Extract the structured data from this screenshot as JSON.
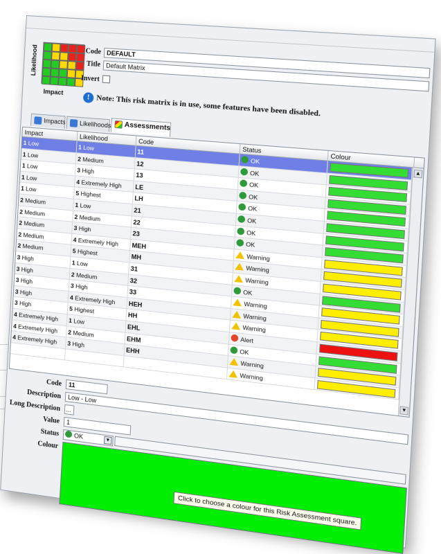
{
  "matrix": {
    "ylabel": "Likelihood",
    "xlabel": "Impact",
    "cells": [
      [
        "#22cc22",
        "#ffd800",
        "#e8221c",
        "#e8221c",
        "#e8221c"
      ],
      [
        "#22cc22",
        "#ffd800",
        "#ffd800",
        "#e8221c",
        "#e8221c"
      ],
      [
        "#22cc22",
        "#22cc22",
        "#ffd800",
        "#ffd800",
        "#e8221c"
      ],
      [
        "#22cc22",
        "#22cc22",
        "#22cc22",
        "#ffd800",
        "#ffd800"
      ],
      [
        "#22cc22",
        "#22cc22",
        "#22cc22",
        "#22cc22",
        "#ffd800"
      ]
    ]
  },
  "header": {
    "code_label": "Code",
    "code_value": "DEFAULT",
    "title_label": "Title",
    "title_value": "Default Matrix",
    "invert_label": "Invert",
    "note": "Note: This risk matrix is in use, some features have been disabled."
  },
  "tabs": [
    {
      "label": "Impacts",
      "icon": "shield-icon"
    },
    {
      "label": "Likelihoods",
      "icon": "shield-icon"
    },
    {
      "label": "Assessments",
      "icon": "matrix-icon"
    }
  ],
  "table": {
    "columns": [
      "Impact",
      "Likelihood",
      "Code",
      "Status",
      "Colour"
    ],
    "rows": [
      {
        "impact_num": "1",
        "impact": "Low",
        "like_num": "1",
        "like": "Low",
        "code": "11",
        "status": "OK",
        "status_type": "ok",
        "colour": "#33dd33"
      },
      {
        "impact_num": "1",
        "impact": "Low",
        "like_num": "2",
        "like": "Medium",
        "code": "12",
        "status": "OK",
        "status_type": "ok",
        "colour": "#33dd33"
      },
      {
        "impact_num": "1",
        "impact": "Low",
        "like_num": "3",
        "like": "High",
        "code": "13",
        "status": "OK",
        "status_type": "ok",
        "colour": "#33dd33"
      },
      {
        "impact_num": "1",
        "impact": "Low",
        "like_num": "4",
        "like": "Extremely High",
        "code": "LE",
        "status": "OK",
        "status_type": "ok",
        "colour": "#33dd33"
      },
      {
        "impact_num": "1",
        "impact": "Low",
        "like_num": "5",
        "like": "Highest",
        "code": "LH",
        "status": "OK",
        "status_type": "ok",
        "colour": "#33dd33"
      },
      {
        "impact_num": "2",
        "impact": "Medium",
        "like_num": "1",
        "like": "Low",
        "code": "21",
        "status": "OK",
        "status_type": "ok",
        "colour": "#33dd33"
      },
      {
        "impact_num": "2",
        "impact": "Medium",
        "like_num": "2",
        "like": "Medium",
        "code": "22",
        "status": "OK",
        "status_type": "ok",
        "colour": "#33dd33"
      },
      {
        "impact_num": "2",
        "impact": "Medium",
        "like_num": "3",
        "like": "High",
        "code": "23",
        "status": "OK",
        "status_type": "ok",
        "colour": "#33dd33"
      },
      {
        "impact_num": "2",
        "impact": "Medium",
        "like_num": "4",
        "like": "Extremely High",
        "code": "MEH",
        "status": "Warning",
        "status_type": "warn",
        "colour": "#ffee00"
      },
      {
        "impact_num": "2",
        "impact": "Medium",
        "like_num": "5",
        "like": "Highest",
        "code": "MH",
        "status": "Warning",
        "status_type": "warn",
        "colour": "#ffee00"
      },
      {
        "impact_num": "3",
        "impact": "High",
        "like_num": "1",
        "like": "Low",
        "code": "31",
        "status": "Warning",
        "status_type": "warn",
        "colour": "#ffee00"
      },
      {
        "impact_num": "3",
        "impact": "High",
        "like_num": "2",
        "like": "Medium",
        "code": "32",
        "status": "OK",
        "status_type": "ok",
        "colour": "#33dd33"
      },
      {
        "impact_num": "3",
        "impact": "High",
        "like_num": "3",
        "like": "High",
        "code": "33",
        "status": "Warning",
        "status_type": "warn",
        "colour": "#ffee00"
      },
      {
        "impact_num": "3",
        "impact": "High",
        "like_num": "4",
        "like": "Extremely High",
        "code": "HEH",
        "status": "Warning",
        "status_type": "warn",
        "colour": "#ffee00"
      },
      {
        "impact_num": "3",
        "impact": "High",
        "like_num": "5",
        "like": "Highest",
        "code": "HH",
        "status": "Warning",
        "status_type": "warn",
        "colour": "#ffee00"
      },
      {
        "impact_num": "4",
        "impact": "Extremely High",
        "like_num": "1",
        "like": "Low",
        "code": "EHL",
        "status": "Alert",
        "status_type": "alert",
        "colour": "#ee1111"
      },
      {
        "impact_num": "4",
        "impact": "Extremely High",
        "like_num": "2",
        "like": "Medium",
        "code": "EHM",
        "status": "OK",
        "status_type": "ok",
        "colour": "#33dd33"
      },
      {
        "impact_num": "4",
        "impact": "Extremely High",
        "like_num": "3",
        "like": "High",
        "code": "EHH",
        "status": "Warning",
        "status_type": "warn",
        "colour": "#ffee00"
      },
      {
        "impact_num": "",
        "impact": "",
        "like_num": "",
        "like": "",
        "code": "",
        "status": "Warning",
        "status_type": "warn",
        "colour": "#ffee00"
      }
    ]
  },
  "form": {
    "code_label": "Code",
    "code_value": "11",
    "description_label": "Description",
    "description_value": "Low - Low",
    "long_description_label": "Long Description",
    "long_description_button": "...",
    "value_label": "Value",
    "value_value": "1",
    "status_label": "Status",
    "status_value": "OK",
    "colour_label": "Colour",
    "colour_value": "#00ee00",
    "tooltip": "Click to choose a colour for this Risk Assessment square."
  }
}
